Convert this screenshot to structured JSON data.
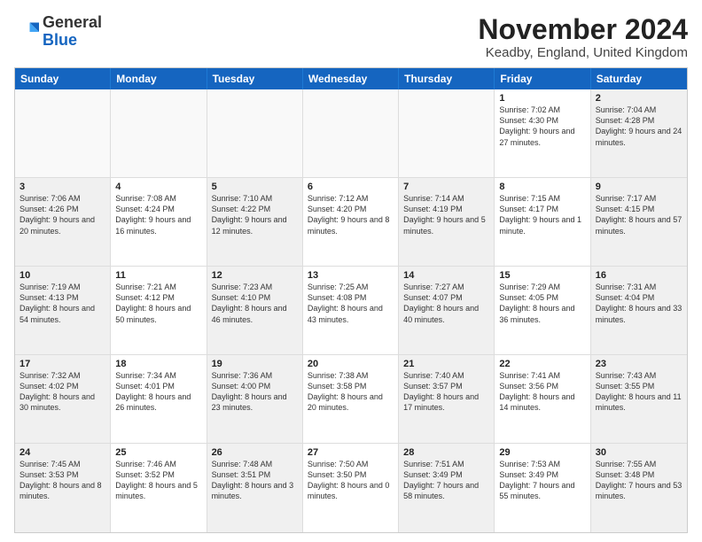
{
  "header": {
    "logo": {
      "line1": "General",
      "line2": "Blue"
    },
    "title": "November 2024",
    "location": "Keadby, England, United Kingdom"
  },
  "weekdays": [
    "Sunday",
    "Monday",
    "Tuesday",
    "Wednesday",
    "Thursday",
    "Friday",
    "Saturday"
  ],
  "rows": [
    [
      {
        "day": "",
        "info": "",
        "shaded": true
      },
      {
        "day": "",
        "info": "",
        "shaded": true
      },
      {
        "day": "",
        "info": "",
        "shaded": true
      },
      {
        "day": "",
        "info": "",
        "shaded": true
      },
      {
        "day": "",
        "info": "",
        "shaded": true
      },
      {
        "day": "1",
        "info": "Sunrise: 7:02 AM\nSunset: 4:30 PM\nDaylight: 9 hours and 27 minutes."
      },
      {
        "day": "2",
        "info": "Sunrise: 7:04 AM\nSunset: 4:28 PM\nDaylight: 9 hours and 24 minutes.",
        "shaded": true
      }
    ],
    [
      {
        "day": "3",
        "info": "Sunrise: 7:06 AM\nSunset: 4:26 PM\nDaylight: 9 hours and 20 minutes.",
        "shaded": true
      },
      {
        "day": "4",
        "info": "Sunrise: 7:08 AM\nSunset: 4:24 PM\nDaylight: 9 hours and 16 minutes."
      },
      {
        "day": "5",
        "info": "Sunrise: 7:10 AM\nSunset: 4:22 PM\nDaylight: 9 hours and 12 minutes.",
        "shaded": true
      },
      {
        "day": "6",
        "info": "Sunrise: 7:12 AM\nSunset: 4:20 PM\nDaylight: 9 hours and 8 minutes."
      },
      {
        "day": "7",
        "info": "Sunrise: 7:14 AM\nSunset: 4:19 PM\nDaylight: 9 hours and 5 minutes.",
        "shaded": true
      },
      {
        "day": "8",
        "info": "Sunrise: 7:15 AM\nSunset: 4:17 PM\nDaylight: 9 hours and 1 minute."
      },
      {
        "day": "9",
        "info": "Sunrise: 7:17 AM\nSunset: 4:15 PM\nDaylight: 8 hours and 57 minutes.",
        "shaded": true
      }
    ],
    [
      {
        "day": "10",
        "info": "Sunrise: 7:19 AM\nSunset: 4:13 PM\nDaylight: 8 hours and 54 minutes.",
        "shaded": true
      },
      {
        "day": "11",
        "info": "Sunrise: 7:21 AM\nSunset: 4:12 PM\nDaylight: 8 hours and 50 minutes."
      },
      {
        "day": "12",
        "info": "Sunrise: 7:23 AM\nSunset: 4:10 PM\nDaylight: 8 hours and 46 minutes.",
        "shaded": true
      },
      {
        "day": "13",
        "info": "Sunrise: 7:25 AM\nSunset: 4:08 PM\nDaylight: 8 hours and 43 minutes."
      },
      {
        "day": "14",
        "info": "Sunrise: 7:27 AM\nSunset: 4:07 PM\nDaylight: 8 hours and 40 minutes.",
        "shaded": true
      },
      {
        "day": "15",
        "info": "Sunrise: 7:29 AM\nSunset: 4:05 PM\nDaylight: 8 hours and 36 minutes."
      },
      {
        "day": "16",
        "info": "Sunrise: 7:31 AM\nSunset: 4:04 PM\nDaylight: 8 hours and 33 minutes.",
        "shaded": true
      }
    ],
    [
      {
        "day": "17",
        "info": "Sunrise: 7:32 AM\nSunset: 4:02 PM\nDaylight: 8 hours and 30 minutes.",
        "shaded": true
      },
      {
        "day": "18",
        "info": "Sunrise: 7:34 AM\nSunset: 4:01 PM\nDaylight: 8 hours and 26 minutes."
      },
      {
        "day": "19",
        "info": "Sunrise: 7:36 AM\nSunset: 4:00 PM\nDaylight: 8 hours and 23 minutes.",
        "shaded": true
      },
      {
        "day": "20",
        "info": "Sunrise: 7:38 AM\nSunset: 3:58 PM\nDaylight: 8 hours and 20 minutes."
      },
      {
        "day": "21",
        "info": "Sunrise: 7:40 AM\nSunset: 3:57 PM\nDaylight: 8 hours and 17 minutes.",
        "shaded": true
      },
      {
        "day": "22",
        "info": "Sunrise: 7:41 AM\nSunset: 3:56 PM\nDaylight: 8 hours and 14 minutes."
      },
      {
        "day": "23",
        "info": "Sunrise: 7:43 AM\nSunset: 3:55 PM\nDaylight: 8 hours and 11 minutes.",
        "shaded": true
      }
    ],
    [
      {
        "day": "24",
        "info": "Sunrise: 7:45 AM\nSunset: 3:53 PM\nDaylight: 8 hours and 8 minutes.",
        "shaded": true
      },
      {
        "day": "25",
        "info": "Sunrise: 7:46 AM\nSunset: 3:52 PM\nDaylight: 8 hours and 5 minutes."
      },
      {
        "day": "26",
        "info": "Sunrise: 7:48 AM\nSunset: 3:51 PM\nDaylight: 8 hours and 3 minutes.",
        "shaded": true
      },
      {
        "day": "27",
        "info": "Sunrise: 7:50 AM\nSunset: 3:50 PM\nDaylight: 8 hours and 0 minutes."
      },
      {
        "day": "28",
        "info": "Sunrise: 7:51 AM\nSunset: 3:49 PM\nDaylight: 7 hours and 58 minutes.",
        "shaded": true
      },
      {
        "day": "29",
        "info": "Sunrise: 7:53 AM\nSunset: 3:49 PM\nDaylight: 7 hours and 55 minutes."
      },
      {
        "day": "30",
        "info": "Sunrise: 7:55 AM\nSunset: 3:48 PM\nDaylight: 7 hours and 53 minutes.",
        "shaded": true
      }
    ]
  ]
}
